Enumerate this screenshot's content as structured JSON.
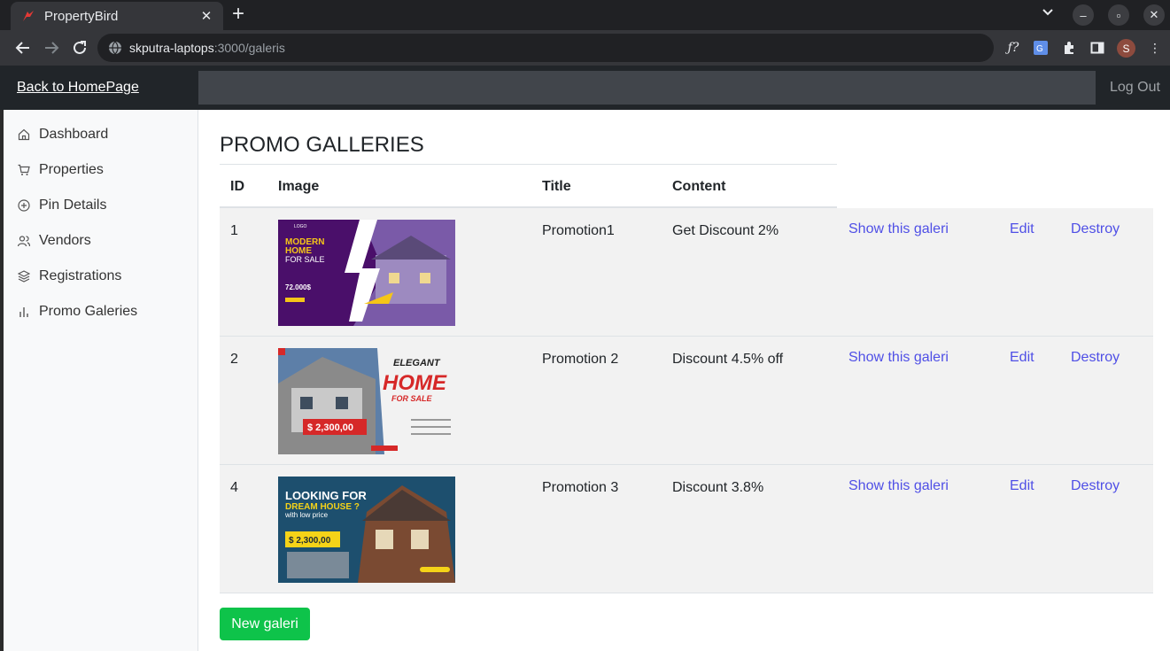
{
  "browser": {
    "tab_title": "PropertyBird",
    "url_host": "skputra-laptops",
    "url_rest": ":3000/galeris",
    "avatar_letter": "S"
  },
  "header": {
    "back_link": "Back to HomePage",
    "logout": "Log Out"
  },
  "sidebar": {
    "items": [
      {
        "label": "Dashboard",
        "icon": "home-icon"
      },
      {
        "label": "Properties",
        "icon": "cart-icon"
      },
      {
        "label": "Pin Details",
        "icon": "plus-circle-icon"
      },
      {
        "label": "Vendors",
        "icon": "users-icon"
      },
      {
        "label": "Registrations",
        "icon": "layers-icon"
      },
      {
        "label": "Promo Galeries",
        "icon": "bar-chart-icon"
      }
    ]
  },
  "main": {
    "title": "PROMO GALLERIES",
    "columns": [
      "ID",
      "Image",
      "Title",
      "Content"
    ],
    "rows": [
      {
        "id": "1",
        "title": "Promotion1",
        "content": "Get Discount 2%",
        "poster": {
          "line1": "MODERN",
          "line2": "HOME",
          "line3": "FOR SALE",
          "price": "72.000$",
          "logo": "LOGO"
        }
      },
      {
        "id": "2",
        "title": "Promotion 2",
        "content": "Discount 4.5% off",
        "poster": {
          "line1": "ELEGANT",
          "line2": "HOME",
          "line3": "FOR SALE",
          "price": "$ 2,300,00"
        }
      },
      {
        "id": "4",
        "title": "Promotion 3",
        "content": "Discount 3.8%",
        "poster": {
          "line1": "LOOKING FOR",
          "line2": "DREAM HOUSE ?",
          "line3": "with low price",
          "price": "$ 2,300,00"
        }
      }
    ],
    "actions": {
      "show": "Show this galeri",
      "edit": "Edit",
      "destroy": "Destroy"
    },
    "new_button": "New galeri"
  }
}
